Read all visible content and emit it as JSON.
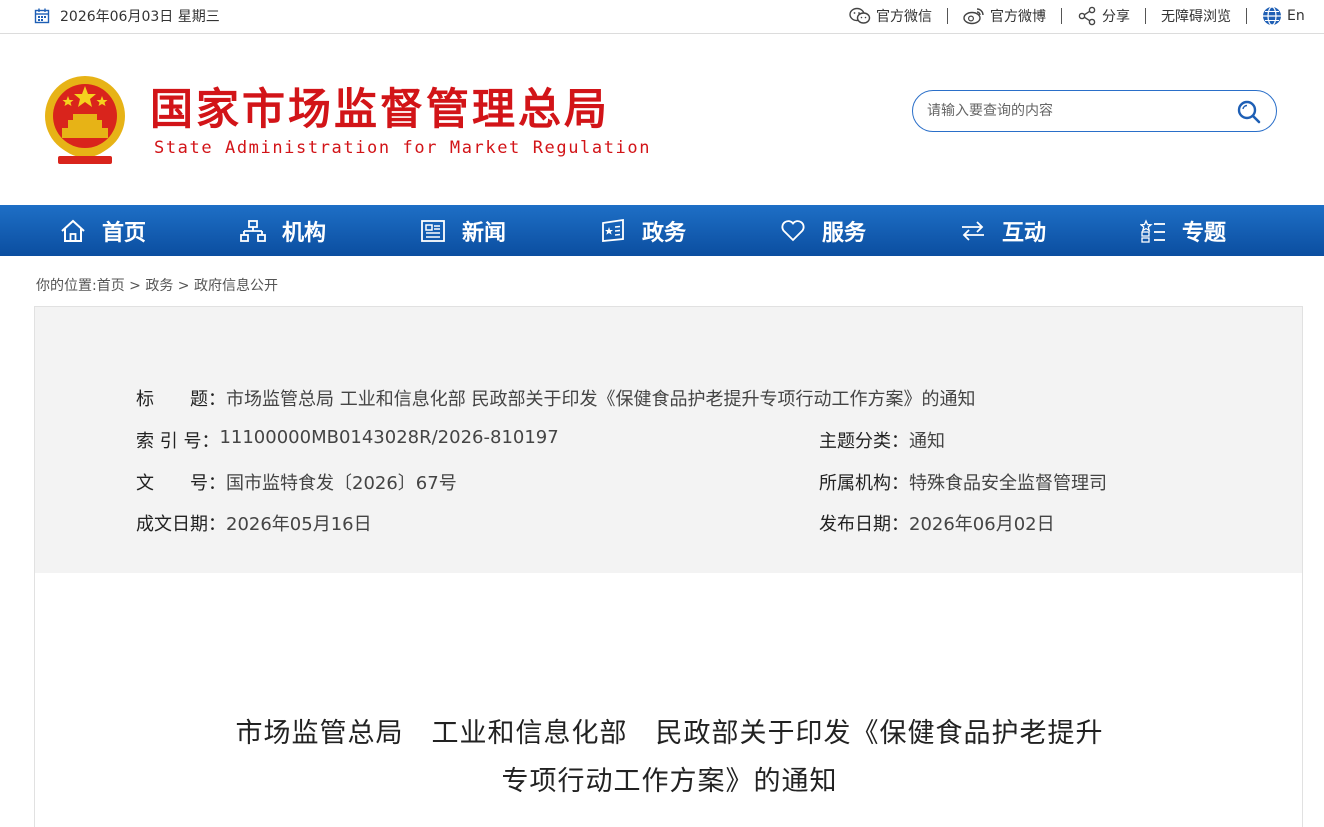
{
  "topbar": {
    "date": "2026年06月03日 星期三",
    "links": [
      {
        "label": "官方微信",
        "icon": "wechat-icon"
      },
      {
        "label": "官方微博",
        "icon": "weibo-icon"
      },
      {
        "label": "分享",
        "icon": "share-icon"
      },
      {
        "label": "无障碍浏览",
        "icon": ""
      },
      {
        "label": "En",
        "icon": "globe-icon"
      }
    ]
  },
  "header": {
    "title_cn": "国家市场监督管理总局",
    "title_en": "State Administration for Market Regulation",
    "search_placeholder": "请输入要查询的内容"
  },
  "nav": {
    "items": [
      {
        "label": "首页",
        "icon": "home-icon"
      },
      {
        "label": "机构",
        "icon": "org-chart-icon"
      },
      {
        "label": "新闻",
        "icon": "news-icon"
      },
      {
        "label": "政务",
        "icon": "government-affairs-icon"
      },
      {
        "label": "服务",
        "icon": "heart-icon"
      },
      {
        "label": "互动",
        "icon": "exchange-icon"
      },
      {
        "label": "专题",
        "icon": "topics-icon"
      }
    ]
  },
  "breadcrumb": {
    "prefix": "你的位置:",
    "items": [
      "首页",
      "政务",
      "政府信息公开"
    ],
    "separator": " > "
  },
  "info": {
    "title_label": "标　　题：",
    "title_value": "市场监管总局 工业和信息化部 民政部关于印发《保健食品护老提升专项行动工作方案》的通知",
    "index_label": "索 引 号：",
    "index_value": "11100000MB0143028R/2026-810197",
    "category_label": "主题分类：",
    "category_value": "通知",
    "docno_label": "文　　号：",
    "docno_value": "国市监特食发〔2026〕67号",
    "org_label": "所属机构：",
    "org_value": "特殊食品安全监督管理司",
    "created_label": "成文日期：",
    "created_value": "2026年05月16日",
    "published_label": "发布日期：",
    "published_value": "2026年06月02日"
  },
  "article": {
    "title_line1": "市场监管总局　工业和信息化部　民政部关于印发《保健食品护老提升",
    "title_line2": "专项行动工作方案》的通知"
  },
  "colors": {
    "brand_red": "#d21418",
    "nav_blue": "#0b4ea0",
    "search_border": "#2a6fc9"
  }
}
